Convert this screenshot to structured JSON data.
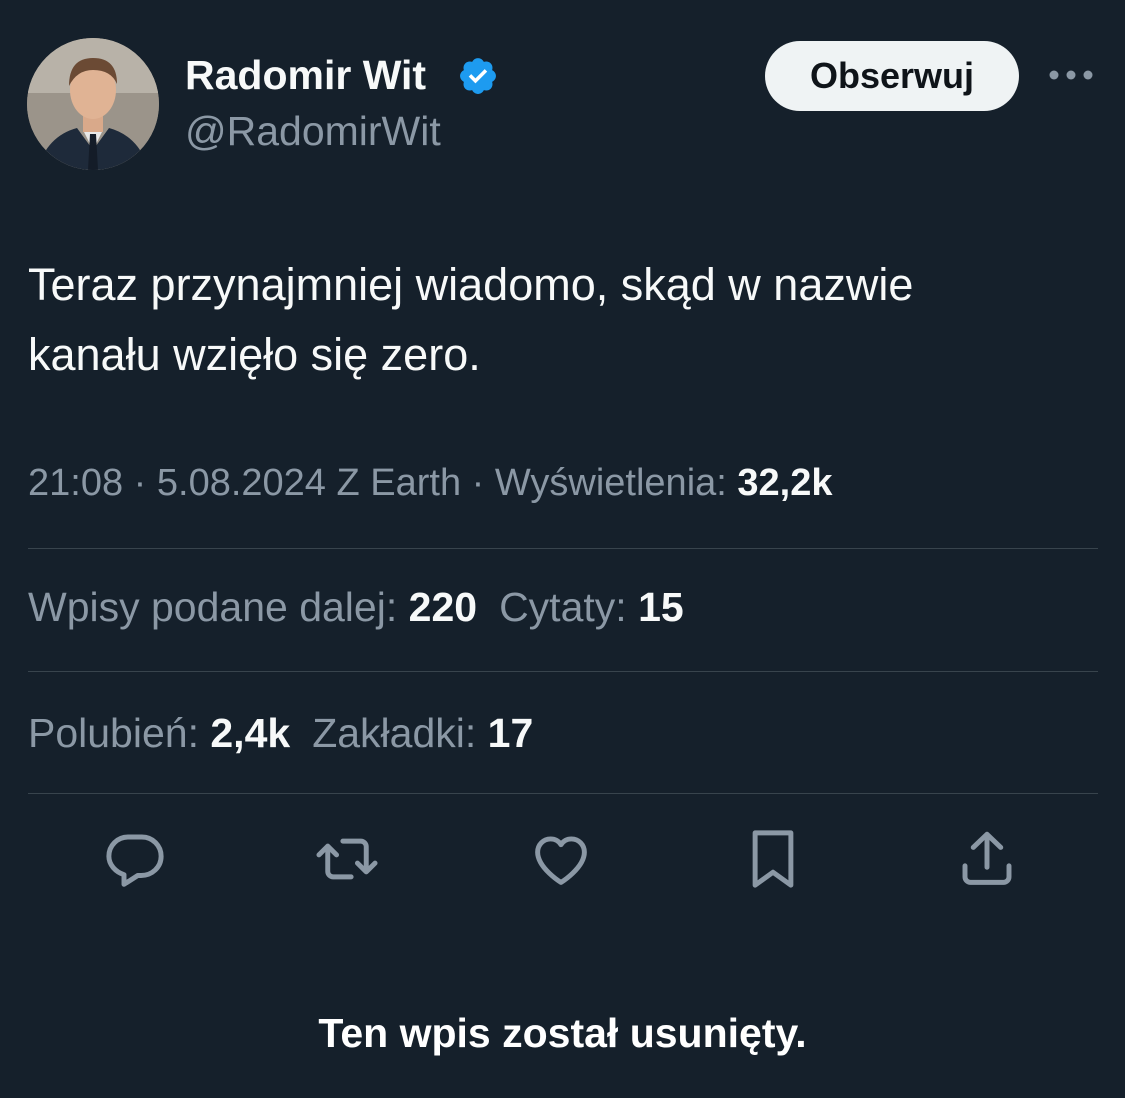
{
  "author": {
    "display_name": "Radomir Wit",
    "handle": "@RadomirWit",
    "verified_icon": "verified-badge-icon",
    "follow_label": "Obserwuj"
  },
  "tweet": {
    "text_line1": "Teraz przynajmniej wiadomo, skąd w nazwie",
    "text_line2": "kanału wzięło się zero."
  },
  "meta": {
    "time": "21:08",
    "sep1": " · ",
    "date": "5.08.2024",
    "source": " Z Earth",
    "sep2": " · ",
    "views_label": "Wyświetlenia:",
    "views_value": "32,2k"
  },
  "stats": {
    "reposts_label": "Wpisy podane dalej:",
    "reposts_value": "220",
    "quotes_label": "Cytaty:",
    "quotes_value": "15",
    "likes_label": "Polubień:",
    "likes_value": "2,4k",
    "bookmarks_label": "Zakładki:",
    "bookmarks_value": "17"
  },
  "actions": [
    "reply-icon",
    "repost-icon",
    "like-icon",
    "bookmark-icon",
    "share-icon"
  ],
  "footer": {
    "deleted_note": "Ten wpis został usunięty."
  },
  "colors": {
    "background": "#15202b",
    "primary_text": "#f7f9f9",
    "secondary_text": "#8b98a5",
    "divider": "#38444d",
    "verified_blue": "#1d9bf0",
    "button_bg": "#eff3f4"
  }
}
